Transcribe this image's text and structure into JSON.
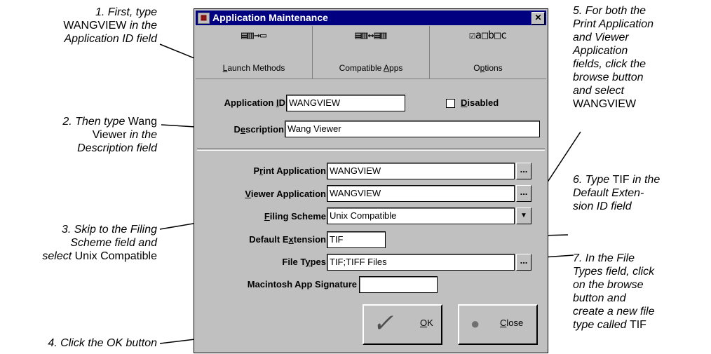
{
  "callouts": {
    "c1": {
      "line1": "1. First, type",
      "line2_up": "WANGVIEW",
      "line2_it": " in the",
      "line3": "Application ID field"
    },
    "c2": {
      "line1_it": "2. Then type ",
      "line1_up": "Wang",
      "line2_up": "Viewer",
      "line2_it": " in the",
      "line3": "Description field"
    },
    "c3": {
      "line1": "3. Skip to the Filing",
      "line2": "Scheme field and",
      "line3_it": "select ",
      "line3_up": "Unix Compatible"
    },
    "c4": {
      "line1": "4. Click the OK button"
    },
    "c5": {
      "line1": "5. For both the",
      "line2": "Print Application",
      "line3": "and Viewer",
      "line4": "Application",
      "line5": "fields, click the",
      "line6": "browse button",
      "line7": "and select",
      "line8_up": "WANGVIEW"
    },
    "c6": {
      "line1_it": "6. Type ",
      "line1_up": "TIF",
      "line1_it2": " in the",
      "line2": "Default Exten-",
      "line3": "sion ID field"
    },
    "c7": {
      "line1": "7. In the File",
      "line2": "Types field, click",
      "line3": "on the browse",
      "line4": "button and",
      "line5": "create a new file",
      "line6_it": "type called ",
      "line6_up": "TIF"
    }
  },
  "dialog": {
    "title": "Application Maintenance",
    "close_glyph": "✕",
    "app_icon_glyph": "▦",
    "tabs": [
      {
        "icon": "▤▥→▭",
        "label_pre": "",
        "label_u": "L",
        "label_post": "aunch Methods"
      },
      {
        "icon": "▤▥↔▤▥",
        "label_pre": "Compatible ",
        "label_u": "A",
        "label_post": "pps"
      },
      {
        "icon": "☑a□b□c",
        "label_pre": "O",
        "label_u": "p",
        "label_post": "tions"
      }
    ],
    "app_id": {
      "label_pre": "Application ",
      "label_u": "I",
      "label_post": "D",
      "value": "WANGVIEW"
    },
    "disabled": {
      "label_u": "D",
      "label_post": "isabled",
      "checked": false
    },
    "description": {
      "label_pre": "D",
      "label_u": "e",
      "label_post": "scription",
      "value": "Wang Viewer"
    },
    "print_app": {
      "label_pre": "P",
      "label_u": "r",
      "label_post": "int Application",
      "value": "WANGVIEW",
      "browse": "..."
    },
    "viewer_app": {
      "label_pre": "",
      "label_u": "V",
      "label_post": "iewer Application",
      "value": "WANGVIEW",
      "browse": "..."
    },
    "filing": {
      "label_pre": "",
      "label_u": "F",
      "label_post": "iling Scheme",
      "value": "Unix Compatible",
      "arrow": "▼"
    },
    "default_ext": {
      "label_pre": "Default E",
      "label_u": "x",
      "label_post": "tension",
      "value": "TIF"
    },
    "file_types": {
      "label_pre": "File T",
      "label_u": "y",
      "label_post": "pes",
      "value": "TIF;TIFF Files",
      "browse": "..."
    },
    "mac_sig": {
      "label": "Macintosh App Signature",
      "value": ""
    },
    "ok": {
      "label_u": "O",
      "label_post": "K",
      "icon_glyph": "✓"
    },
    "close_btn": {
      "label_u": "C",
      "label_post": "lose",
      "icon_glyph": "●"
    }
  }
}
